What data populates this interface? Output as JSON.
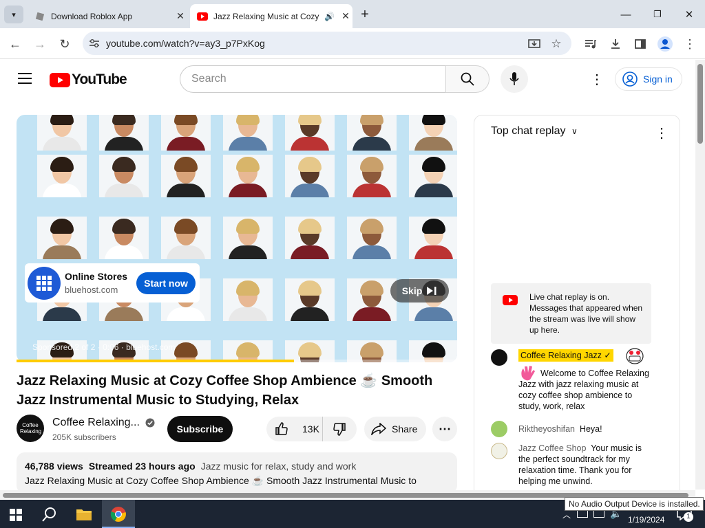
{
  "browser": {
    "tabs": [
      {
        "title": "Download Roblox App",
        "active": false
      },
      {
        "title": "Jazz Relaxing Music at Cozy",
        "active": true
      }
    ],
    "url": "youtube.com/watch?v=ay3_p7PxKog"
  },
  "header": {
    "logo_text": "YouTube",
    "search_placeholder": "Search",
    "signin_label": "Sign in"
  },
  "video": {
    "ad": {
      "advertiser": "Online Stores",
      "domain": "bluehost.com",
      "cta": "Start now",
      "skip_label": "Skip",
      "sponsor_text": "Sponsored 2 of 2 · 0:06 · bluehost.com"
    },
    "progress": 0.63,
    "title": "Jazz Relaxing Music at Cozy Coffee Shop Ambience ☕ Smooth Jazz Instrumental Music to Studying, Relax"
  },
  "channel": {
    "name": "Coffee Relaxing...",
    "subscribers": "205K subscribers",
    "subscribe_label": "Subscribe",
    "avatar_text": "Coffee Relaxing"
  },
  "actions": {
    "likes": "13K",
    "share_label": "Share"
  },
  "description": {
    "views": "46,788 views",
    "streamed": "Streamed 23 hours ago",
    "tags": "Jazz music for relax, study and work",
    "text": "Jazz Relaxing Music at Cozy Coffee Shop Ambience ☕ Smooth Jazz Instrumental Music to"
  },
  "chat": {
    "header": "Top chat replay",
    "banner": "Live chat replay is on. Messages that appeared when the stream was live will show up here.",
    "messages": [
      {
        "author": "Coffee Relaxing Jazz",
        "text": "Welcome to Coffee Relaxing Jazz with jazz relaxing music at cozy coffee shop ambience to study, work, relax",
        "owner": true
      },
      {
        "author": "Riktheyoshifan",
        "text": "Heya!"
      },
      {
        "author": "Jazz Coffee Shop",
        "text": "Your music is the perfect soundtrack for my relaxation time. Thank you for helping me unwind."
      }
    ]
  },
  "taskbar": {
    "date": "1/19/2024",
    "tooltip": "No Audio Output Device is installed.",
    "notification_count": "1"
  },
  "colors": {
    "youtube_red": "#ff0000",
    "link_blue": "#065fd4",
    "owner_badge": "#ffd600",
    "tabstrip": "#dde3ea",
    "taskbar": "#1c2533"
  }
}
